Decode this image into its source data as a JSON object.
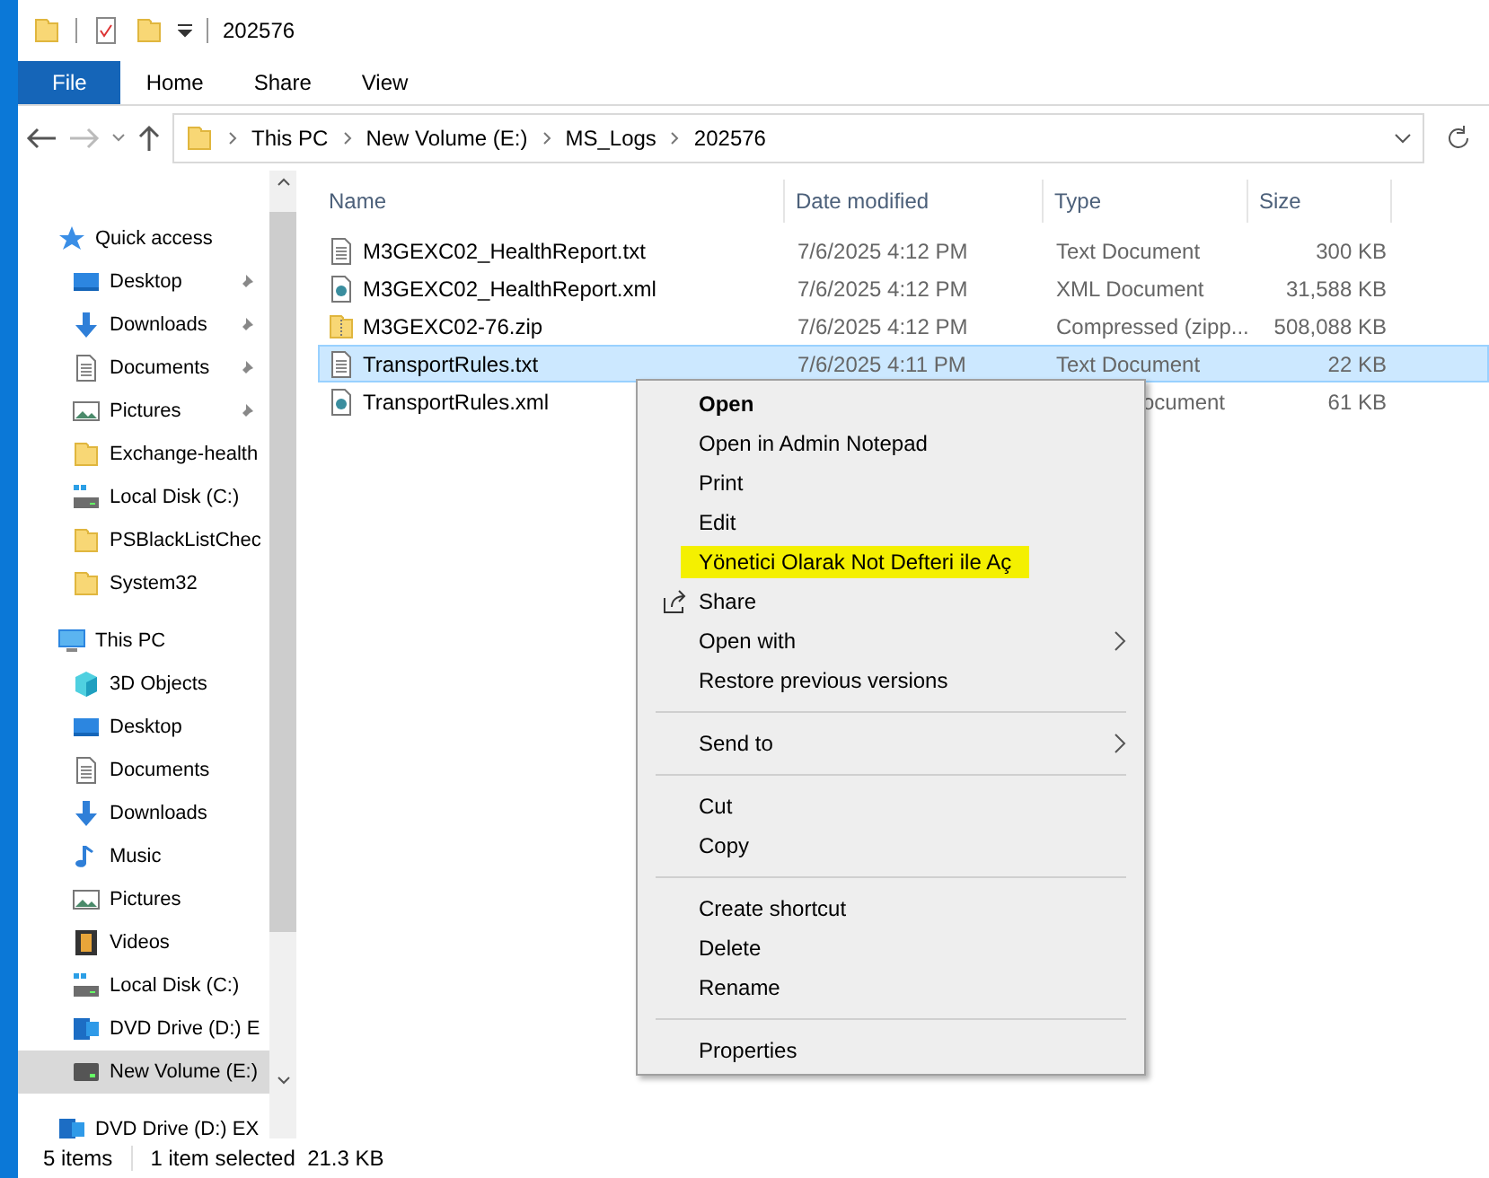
{
  "window": {
    "title": "202576"
  },
  "ribbon_tabs": [
    {
      "label": "File",
      "selected": true
    },
    {
      "label": "Home",
      "selected": false
    },
    {
      "label": "Share",
      "selected": false
    },
    {
      "label": "View",
      "selected": false
    }
  ],
  "breadcrumb": [
    "This PC",
    "New Volume (E:)",
    "MS_Logs",
    "202576"
  ],
  "sidebar": {
    "items": [
      {
        "label": "Quick access",
        "kind": "star",
        "selected": false,
        "children": [
          {
            "label": "Desktop",
            "kind": "desktop",
            "pinned": true,
            "selected": false
          },
          {
            "label": "Downloads",
            "kind": "download",
            "pinned": true,
            "selected": false
          },
          {
            "label": "Documents",
            "kind": "document",
            "pinned": true,
            "selected": false
          },
          {
            "label": "Pictures",
            "kind": "picture",
            "pinned": true,
            "selected": false
          },
          {
            "label": "Exchange-health",
            "kind": "folder",
            "pinned": false,
            "selected": false
          },
          {
            "label": "Local Disk (C:)",
            "kind": "disk",
            "pinned": false,
            "selected": false
          },
          {
            "label": "PSBlackListChec",
            "kind": "folder",
            "pinned": false,
            "selected": false
          },
          {
            "label": "System32",
            "kind": "folder",
            "pinned": false,
            "selected": false
          }
        ]
      },
      {
        "label": "This PC",
        "kind": "pc",
        "selected": false,
        "children": [
          {
            "label": "3D Objects",
            "kind": "cube",
            "selected": false
          },
          {
            "label": "Desktop",
            "kind": "desktop",
            "selected": false
          },
          {
            "label": "Documents",
            "kind": "document",
            "selected": false
          },
          {
            "label": "Downloads",
            "kind": "download",
            "selected": false
          },
          {
            "label": "Music",
            "kind": "music",
            "selected": false
          },
          {
            "label": "Pictures",
            "kind": "picture",
            "selected": false
          },
          {
            "label": "Videos",
            "kind": "video",
            "selected": false
          },
          {
            "label": "Local Disk (C:)",
            "kind": "disk",
            "selected": false
          },
          {
            "label": "DVD Drive (D:) E",
            "kind": "dvd",
            "selected": false
          },
          {
            "label": "New Volume (E:)",
            "kind": "drive",
            "selected": true
          }
        ]
      },
      {
        "label": "DVD Drive (D:) EX",
        "kind": "dvd",
        "selected": false
      }
    ]
  },
  "table": {
    "columns": [
      "Name",
      "Date modified",
      "Type",
      "Size"
    ],
    "rows": [
      {
        "name": "M3GEXC02_HealthReport.txt",
        "kind": "text",
        "date": "7/6/2025 4:12 PM",
        "type": "Text Document",
        "size": "300 KB",
        "selected": false
      },
      {
        "name": "M3GEXC02_HealthReport.xml",
        "kind": "xml",
        "date": "7/6/2025 4:12 PM",
        "type": "XML Document",
        "size": "31,588 KB",
        "selected": false
      },
      {
        "name": "M3GEXC02-76.zip",
        "kind": "zip",
        "date": "7/6/2025 4:12 PM",
        "type": "Compressed (zipp...",
        "size": "508,088 KB",
        "selected": false
      },
      {
        "name": "TransportRules.txt",
        "kind": "text",
        "date": "7/6/2025 4:11 PM",
        "type": "Text Document",
        "size": "22 KB",
        "selected": true
      },
      {
        "name": "TransportRules.xml",
        "kind": "xml",
        "type": "ocument",
        "type_partial": true,
        "size": "61 KB",
        "selected": false
      }
    ]
  },
  "context_menu": {
    "groups": [
      [
        {
          "label": "Open",
          "bold": true
        },
        {
          "label": "Open in Admin Notepad"
        },
        {
          "label": "Print"
        },
        {
          "label": "Edit"
        },
        {
          "label": "Yönetici Olarak Not Defteri ile Aç",
          "highlighted": true
        },
        {
          "label": "Share",
          "kind": "share"
        },
        {
          "label": "Open with",
          "submenu": true
        },
        {
          "label": "Restore previous versions"
        }
      ],
      [
        {
          "label": "Send to",
          "submenu": true
        }
      ],
      [
        {
          "label": "Cut"
        },
        {
          "label": "Copy"
        }
      ],
      [
        {
          "label": "Create shortcut"
        },
        {
          "label": "Delete"
        },
        {
          "label": "Rename"
        }
      ],
      [
        {
          "label": "Properties"
        }
      ]
    ]
  },
  "status_bar": {
    "item_count": "5 items",
    "selection": "1 item selected  21.3 KB"
  }
}
